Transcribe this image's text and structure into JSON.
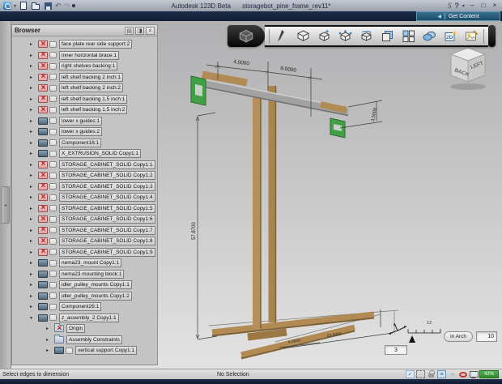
{
  "window": {
    "title_app": "Autodesk 123D Beta",
    "title_doc": "storagebot_pine_frame_rev11*"
  },
  "menubar": {
    "get_content": "Get Content"
  },
  "browser": {
    "title": "Browser",
    "items": [
      {
        "label": "face plate rear side support:2",
        "icon": "hidden",
        "ind": "i0",
        "exp": "collapsed"
      },
      {
        "label": "inner horizontal brace:1",
        "icon": "hidden",
        "ind": "i0",
        "exp": "collapsed"
      },
      {
        "label": "right shelves backing:1",
        "icon": "hidden",
        "ind": "i0",
        "exp": "collapsed"
      },
      {
        "label": "left shelf backing 2 inch:1",
        "icon": "hidden",
        "ind": "i0",
        "exp": "collapsed"
      },
      {
        "label": "left shelf backing 2 inch:2",
        "icon": "hidden",
        "ind": "i0",
        "exp": "collapsed"
      },
      {
        "label": "left shelf backing 1.5 inch:1",
        "icon": "hidden",
        "ind": "i0",
        "exp": "collapsed"
      },
      {
        "label": "left shelf backing 1.5 inch:2",
        "icon": "hidden",
        "ind": "i0",
        "exp": "collapsed"
      },
      {
        "label": "lower x guides:1",
        "icon": "comp",
        "ind": "i0",
        "exp": "collapsed"
      },
      {
        "label": "lower x guides:2",
        "icon": "comp",
        "ind": "i0",
        "exp": "collapsed"
      },
      {
        "label": "Component16:1",
        "icon": "comp",
        "ind": "i0",
        "exp": "collapsed"
      },
      {
        "label": "X_EXTRUSION_SOLID Copy1:1",
        "icon": "comp",
        "ind": "i0",
        "exp": "collapsed"
      },
      {
        "label": "STORAGE_CABINET_SOLID Copy1:1",
        "icon": "hidden",
        "ind": "i0",
        "exp": "collapsed"
      },
      {
        "label": "STORAGE_CABINET_SOLID Copy1:2",
        "icon": "hidden",
        "ind": "i0",
        "exp": "collapsed"
      },
      {
        "label": "STORAGE_CABINET_SOLID Copy1:3",
        "icon": "hidden",
        "ind": "i0",
        "exp": "collapsed"
      },
      {
        "label": "STORAGE_CABINET_SOLID Copy1:4",
        "icon": "hidden",
        "ind": "i0",
        "exp": "collapsed"
      },
      {
        "label": "STORAGE_CABINET_SOLID Copy1:5",
        "icon": "hidden",
        "ind": "i0",
        "exp": "collapsed"
      },
      {
        "label": "STORAGE_CABINET_SOLID Copy1:6",
        "icon": "hidden",
        "ind": "i0",
        "exp": "collapsed"
      },
      {
        "label": "STORAGE_CABINET_SOLID Copy1:7",
        "icon": "hidden",
        "ind": "i0",
        "exp": "collapsed"
      },
      {
        "label": "STORAGE_CABINET_SOLID Copy1:8",
        "icon": "hidden",
        "ind": "i0",
        "exp": "collapsed"
      },
      {
        "label": "STORAGE_CABINET_SOLID Copy1:9",
        "icon": "hidden",
        "ind": "i0",
        "exp": "collapsed"
      },
      {
        "label": "nema23_mount Copy1:1",
        "icon": "comp",
        "ind": "i0",
        "exp": "collapsed"
      },
      {
        "label": "nema23 mounting block:1",
        "icon": "comp",
        "ind": "i0",
        "exp": "collapsed"
      },
      {
        "label": "idler_pulley_mounts Copy1:1",
        "icon": "comp",
        "ind": "i0",
        "exp": "collapsed"
      },
      {
        "label": "idler_pulley_mounts Copy1:2",
        "icon": "comp",
        "ind": "i0",
        "exp": "collapsed"
      },
      {
        "label": "Component26:1",
        "icon": "comp",
        "ind": "i0",
        "exp": "collapsed"
      },
      {
        "label": "z_assembly_2 Copy1:1",
        "icon": "comp",
        "ind": "i0",
        "exp": "expanded"
      },
      {
        "label": "Origin",
        "icon": "origin",
        "ind": "i1",
        "exp": "collapsed"
      },
      {
        "label": "Assembly Constraints",
        "icon": "folder",
        "ind": "i1",
        "exp": "collapsed"
      },
      {
        "label": "vertical support Copy1:1",
        "icon": "comp",
        "ind": "i1",
        "exp": "collapsed"
      }
    ]
  },
  "toolbar": {
    "tools": [
      "app-menu-cube",
      "pen-tool",
      "primitive-box",
      "tweak-move",
      "scale",
      "revolve",
      "pattern",
      "grid-pattern",
      "combine",
      "sketch-2d",
      "decal-image"
    ]
  },
  "viewcube": {
    "faces": [
      "BACK",
      "LEFT"
    ]
  },
  "viewport": {
    "dimensions": {
      "top_left": "4.0000",
      "top_right": "9.0000",
      "beam_height": "3.5000",
      "post_height": "57.8700",
      "base_long": "23.0000",
      "base_short": "4.0000"
    }
  },
  "units": {
    "scale_tick": "12",
    "unit": "in Arch",
    "grid": "10",
    "snap": "3"
  },
  "statusbar": {
    "prompt": "Select edges to dimension",
    "selection": "No Selection",
    "perf": "42%"
  }
}
